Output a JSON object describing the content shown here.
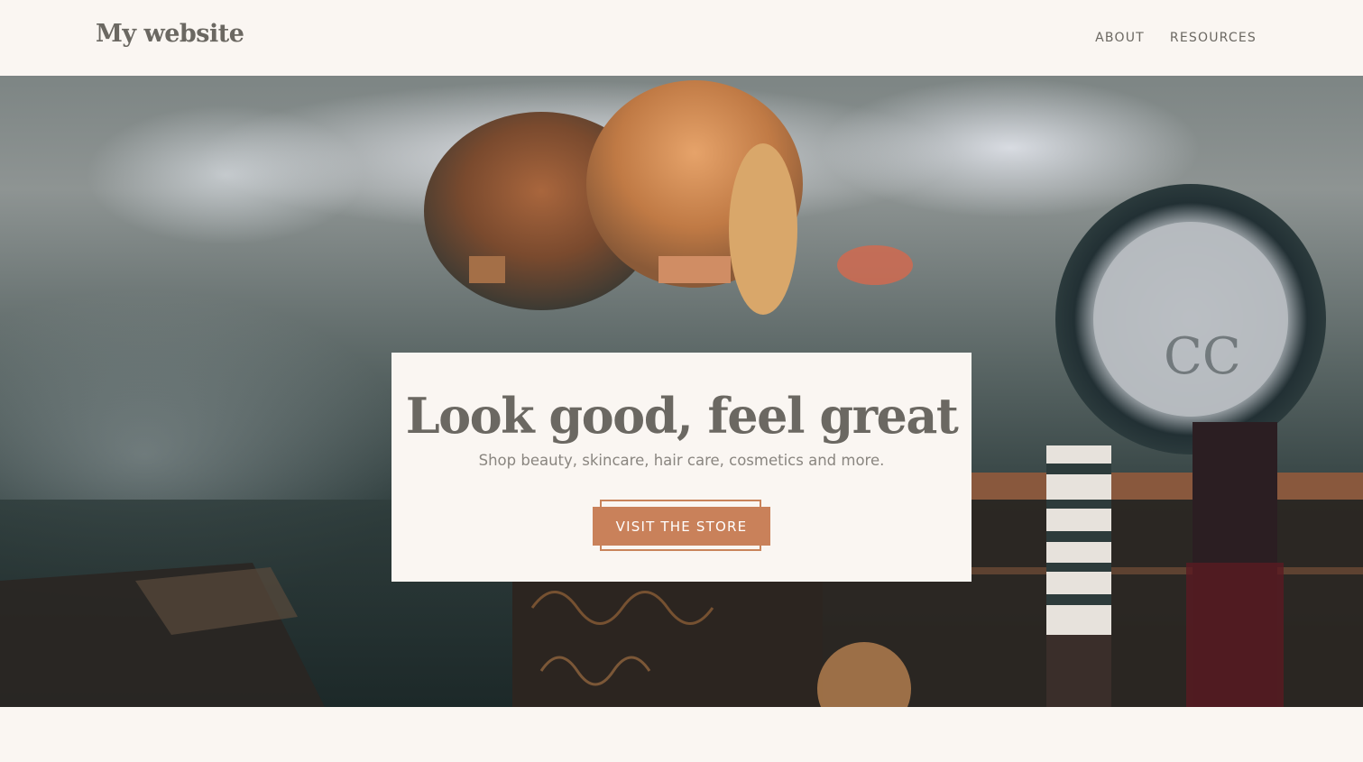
{
  "header": {
    "site_title": "My website",
    "nav": [
      {
        "label": "ABOUT"
      },
      {
        "label": "RESOURCES"
      }
    ]
  },
  "hero": {
    "image_description_icon": "makeup-brushes-photo",
    "headline": "Look good, feel great",
    "subtitle": "Shop beauty, skincare, hair care, cosmetics and more.",
    "cta_label": "VISIT THE STORE"
  },
  "colors": {
    "background": "#faf6f2",
    "text": "#6b6862",
    "accent": "#c9815a"
  }
}
